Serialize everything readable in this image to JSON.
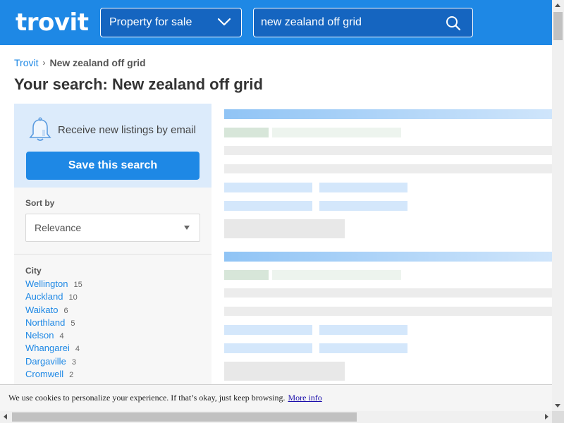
{
  "header": {
    "logo": "trovit",
    "property_type": "Property for sale",
    "search_value": "new zealand off grid"
  },
  "breadcrumb": {
    "home": "Trovit",
    "separator": "›",
    "current": "New zealand off grid"
  },
  "page_title": "Your search: New zealand off grid",
  "alert": {
    "text": "Receive new listings by email",
    "button": "Save this search"
  },
  "sort": {
    "label": "Sort by",
    "selected": "Relevance"
  },
  "city_filter": {
    "title": "City",
    "items": [
      {
        "name": "Wellington",
        "count": "15"
      },
      {
        "name": "Auckland",
        "count": "10"
      },
      {
        "name": "Waikato",
        "count": "6"
      },
      {
        "name": "Northland",
        "count": "5"
      },
      {
        "name": "Nelson",
        "count": "4"
      },
      {
        "name": "Whangarei",
        "count": "4"
      },
      {
        "name": "Dargaville",
        "count": "3"
      },
      {
        "name": "Cromwell",
        "count": "2"
      }
    ]
  },
  "cookie_bar": {
    "text": "We use cookies to personalize your experience. If that’s okay, just keep browsing.",
    "link": "More info"
  },
  "colors": {
    "brand_blue": "#1e88e5",
    "header_field": "#1565c0",
    "alert_bg": "#dcebfb"
  }
}
